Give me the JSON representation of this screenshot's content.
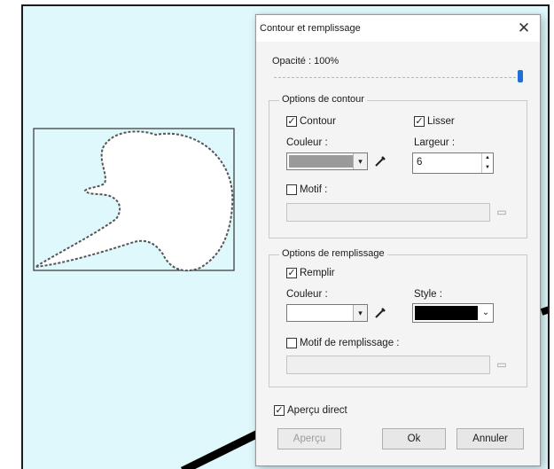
{
  "dialog": {
    "title": "Contour et remplissage",
    "close_symbol": "✕",
    "opacity_label": "Opacité : 100%",
    "opacity_value": 1.0,
    "stroke": {
      "group_title": "Options de contour",
      "contour_label": "Contour",
      "contour_checked": true,
      "smooth_label": "Lisser",
      "smooth_checked": true,
      "color_label": "Couleur :",
      "color_value": "#9a9a9a",
      "width_label": "Largeur :",
      "width_value": "6",
      "pattern_label": "Motif :",
      "pattern_checked": false,
      "pattern_path": ""
    },
    "fill": {
      "group_title": "Options de remplissage",
      "fill_label": "Remplir",
      "fill_checked": true,
      "color_label": "Couleur :",
      "color_value": "#ffffff",
      "style_label": "Style :",
      "style_value": "#000000",
      "pattern_label": "Motif de remplissage :",
      "pattern_checked": false,
      "pattern_path": ""
    },
    "live_preview_label": "Aperçu direct",
    "live_preview_checked": true,
    "buttons": {
      "preview": "Aperçu",
      "ok": "Ok",
      "cancel": "Annuler"
    }
  },
  "icons": {
    "close": "close-icon",
    "pipette": "eyedropper-icon",
    "browse": "folder-icon",
    "dropdown": "chevron-down-icon"
  },
  "colors": {
    "canvas_background": "#dff8fc",
    "slider_thumb": "#1f6fd6"
  }
}
